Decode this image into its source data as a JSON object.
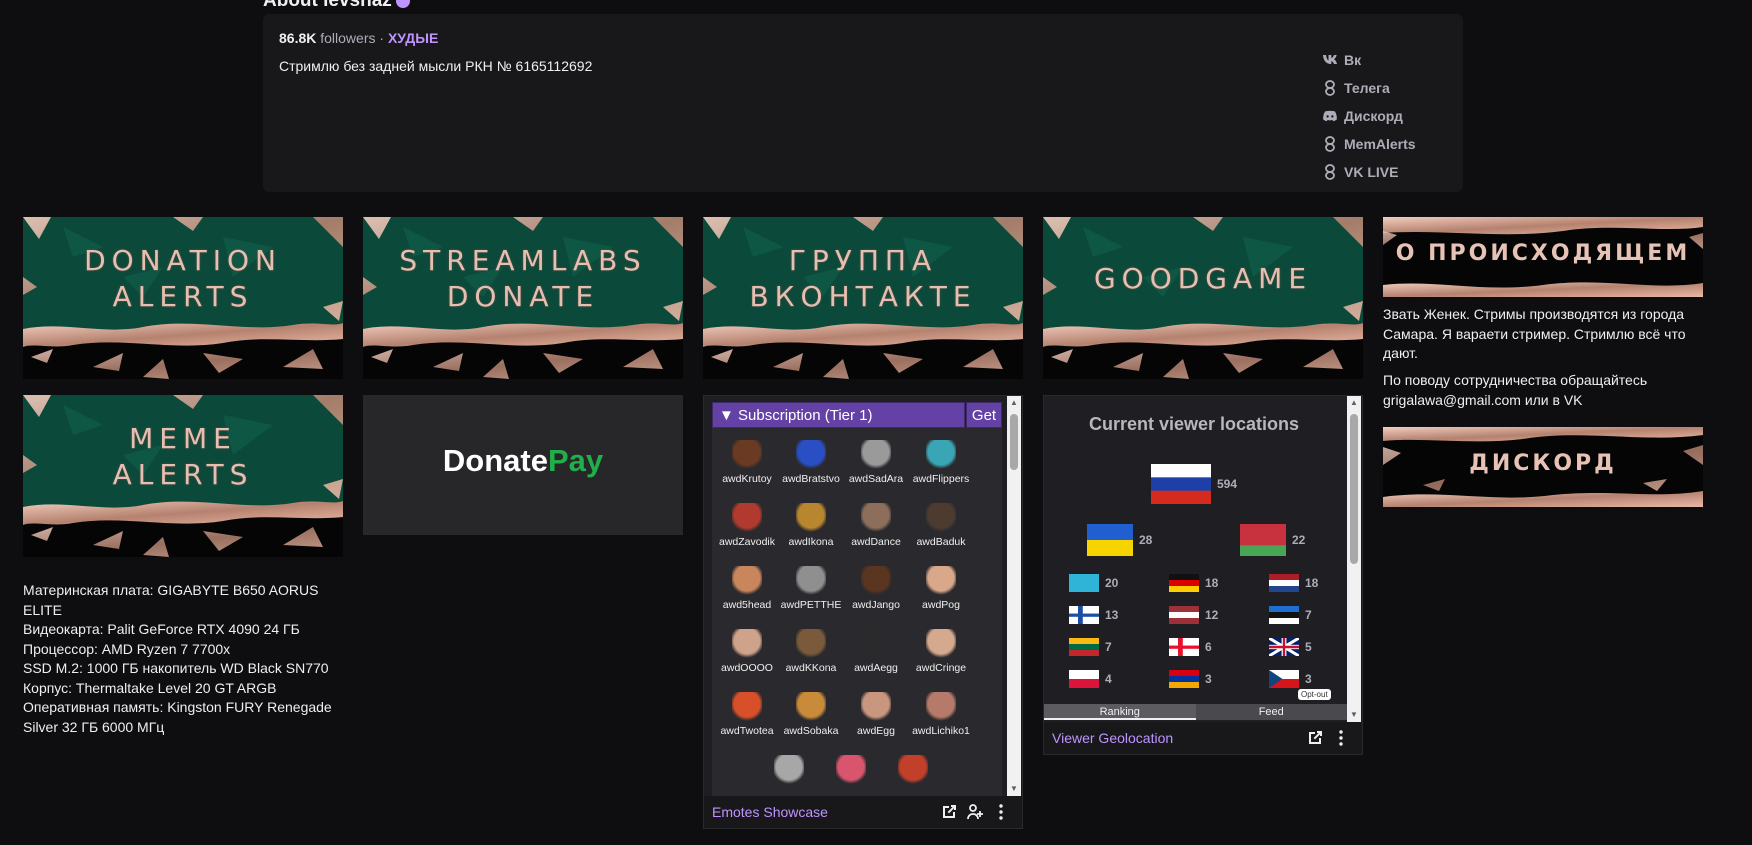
{
  "about": {
    "title": "About levshaz",
    "followers_count": "86.8K",
    "followers_label": " followers · ",
    "team": "ХУДЫЕ",
    "description": "Стримлю без задней мысли РКН № 6165112692",
    "socials": [
      {
        "label": "Вк",
        "icon": "vk-icon"
      },
      {
        "label": "Телега",
        "icon": "link-icon"
      },
      {
        "label": "Дискорд",
        "icon": "discord-icon"
      },
      {
        "label": "MemAlerts",
        "icon": "link-icon"
      },
      {
        "label": "VK LIVE",
        "icon": "link-icon"
      }
    ]
  },
  "panels": {
    "donation_alerts": [
      "DONATION",
      "ALERTS"
    ],
    "streamlabs": [
      "STREAMLABS",
      "DONATE"
    ],
    "vk_group": [
      "ГРУППА",
      "ВКОНТАКТЕ"
    ],
    "goodgame": [
      "GOODGAME"
    ],
    "meme_alerts": [
      "MEME",
      "ALERTS"
    ],
    "about_banner": "О ПРОИСХОДЯЩЕМ",
    "discord_banner": "ДИСКОРД",
    "donatepay": {
      "part1": "Donate",
      "part2": "Pay"
    },
    "about_text": "Звать Женек. Стримы производятся из города Самара. Я вараети стример. Стримлю всё что дают.",
    "contact_text": "По поводу сотрудничества обращайтесь grigalawa@gmail.com или в VK",
    "specs": [
      "Материнская плата: GIGABYTE B650 AORUS ELITE",
      "Видеокарта: Palit GeForce RTX 4090 24 ГБ",
      "Процессор: AMD Ryzen 7 7700x",
      "SSD M.2: 1000 ГБ накопитель WD Black SN770",
      "Корпус: Thermaltake Level 20 GT ARGB",
      "Оперативная память: Kingston FURY Renegade Silver 32 ГБ 6000 МГц"
    ]
  },
  "emotes_ext": {
    "header": "▼ Subscription (Tier 1)",
    "get": "Get",
    "footer": "Emotes Showcase",
    "emotes": [
      {
        "name": "awdKrutoy",
        "color": "#6b3a22"
      },
      {
        "name": "awdBratstvo",
        "color": "#2a4fc4"
      },
      {
        "name": "awdSadAra",
        "color": "#9a9a9a"
      },
      {
        "name": "awdFlippers",
        "color": "#3aa6b5"
      },
      {
        "name": "awdZavodik",
        "color": "#b03a2e"
      },
      {
        "name": "awdIkona",
        "color": "#b8862e"
      },
      {
        "name": "awdDance",
        "color": "#8c6e5a"
      },
      {
        "name": "awdBaduk",
        "color": "#4d3b30"
      },
      {
        "name": "awd5head",
        "color": "#c9855b"
      },
      {
        "name": "awdPETTHE",
        "color": "#8f8f8f"
      },
      {
        "name": "awdJango",
        "color": "#5a3520"
      },
      {
        "name": "awdPog",
        "color": "#d9a88a"
      },
      {
        "name": "awdOOOO",
        "color": "#cfa28a"
      },
      {
        "name": "awdKKona",
        "color": "#7a5a3a"
      },
      {
        "name": "awdAegg",
        "color": "#2a2a2d"
      },
      {
        "name": "awdCringe",
        "color": "#d4a98e"
      },
      {
        "name": "awdTwotea",
        "color": "#d8502a"
      },
      {
        "name": "awdSobaka",
        "color": "#c98a3a"
      },
      {
        "name": "awdEgg",
        "color": "#c99680"
      },
      {
        "name": "awdLichiko1",
        "color": "#b57a6a"
      },
      {
        "name": "",
        "color": "#a7a7a7"
      },
      {
        "name": "",
        "color": "#d9556e"
      },
      {
        "name": "",
        "color": "#c2402a"
      }
    ]
  },
  "geo_ext": {
    "title": "Current viewer locations",
    "footer": "Viewer Geolocation",
    "tabs": [
      "Ranking",
      "Feed"
    ],
    "optout": "Opt-out",
    "flags": [
      {
        "country": "Russia",
        "count": "594"
      },
      {
        "country": "Ukraine",
        "count": "28"
      },
      {
        "country": "Belarus",
        "count": "22"
      },
      {
        "country": "Kazakhstan",
        "count": "20"
      },
      {
        "country": "Germany",
        "count": "18"
      },
      {
        "country": "Netherlands",
        "count": "18"
      },
      {
        "country": "Finland",
        "count": "13"
      },
      {
        "country": "Latvia",
        "count": "12"
      },
      {
        "country": "Estonia",
        "count": "7"
      },
      {
        "country": "Lithuania",
        "count": "7"
      },
      {
        "country": "Georgia",
        "count": "6"
      },
      {
        "country": "United Kingdom",
        "count": "5"
      },
      {
        "country": "Poland",
        "count": "4"
      },
      {
        "country": "Armenia",
        "count": "3"
      },
      {
        "country": "Czechia",
        "count": "3"
      }
    ]
  }
}
